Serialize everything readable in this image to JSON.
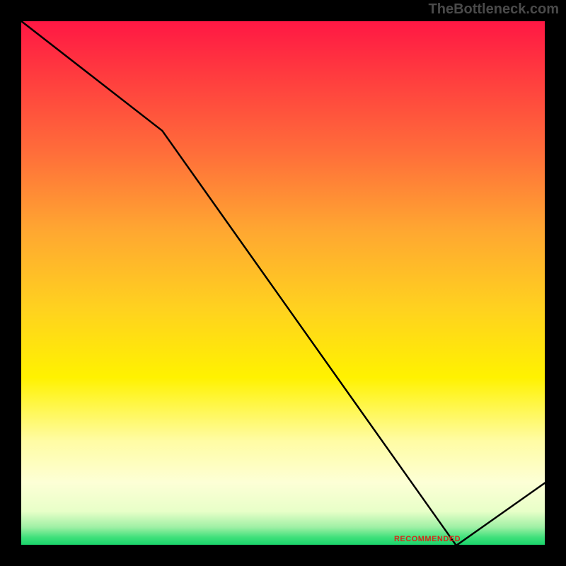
{
  "watermark": "TheBottleneck.com",
  "chart_data": {
    "type": "line",
    "title": "",
    "xlabel": "",
    "ylabel": "",
    "xlim": [
      0,
      100
    ],
    "ylim": [
      0,
      100
    ],
    "x": [
      0,
      27,
      83,
      100
    ],
    "values": [
      100,
      79,
      0,
      12
    ],
    "recommended_x": [
      70,
      85
    ],
    "recommended_label": "RECOMMENDED",
    "background_stops": [
      {
        "offset": 0.0,
        "color": "#ff1744"
      },
      {
        "offset": 0.1,
        "color": "#ff3a3f"
      },
      {
        "offset": 0.25,
        "color": "#ff6d3a"
      },
      {
        "offset": 0.4,
        "color": "#ffa731"
      },
      {
        "offset": 0.55,
        "color": "#ffd21f"
      },
      {
        "offset": 0.68,
        "color": "#fff200"
      },
      {
        "offset": 0.8,
        "color": "#fffca3"
      },
      {
        "offset": 0.88,
        "color": "#fdffd6"
      },
      {
        "offset": 0.935,
        "color": "#e8ffc8"
      },
      {
        "offset": 0.965,
        "color": "#9ff0a5"
      },
      {
        "offset": 0.985,
        "color": "#3de07a"
      },
      {
        "offset": 1.0,
        "color": "#17d36a"
      }
    ]
  }
}
